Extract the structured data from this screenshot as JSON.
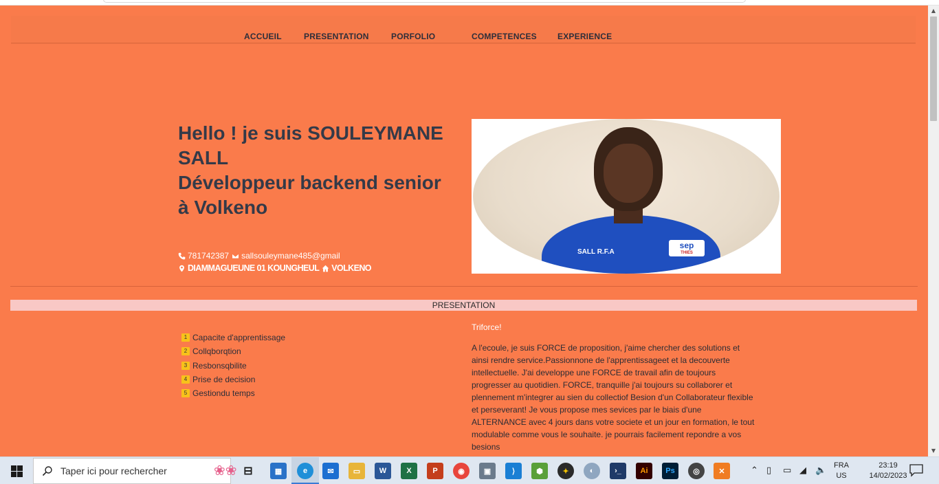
{
  "nav": {
    "items": [
      "ACCUEIL",
      "PRESENTATION",
      "PORFOLIO",
      "COMPETENCES",
      "EXPERIENCE"
    ]
  },
  "hero": {
    "line1": "Hello ! je suis SOULEYMANE",
    "line2": "SALL",
    "line3": "Développeur backend senior",
    "line4": "à Volkeno",
    "phone": "781742387",
    "email": "sallsouleymane485@gmail",
    "address": "DIAMMAGUEUNE 01 KOUNGHEUL",
    "company": "VOLKENO",
    "photo_shirt_text": "SALL R.F.A",
    "photo_badge_text": "sep",
    "photo_badge_sub": "THIES"
  },
  "section": {
    "title": "PRESENTATION"
  },
  "skills": [
    {
      "num": "1",
      "label": "Capacite d'apprentissage"
    },
    {
      "num": "2",
      "label": "Collqborqtion"
    },
    {
      "num": "3",
      "label": "Resbonsqbilite"
    },
    {
      "num": "4",
      "label": "Prise de decision"
    },
    {
      "num": "5",
      "label": "Gestiondu temps"
    }
  ],
  "presentation": {
    "tagline": "Triforce!",
    "body": "A l'ecoule, je suis FORCE de proposition, j'aime chercher des solutions et ainsi rendre service.Passionnone de l'apprentissageet et la decouverte intellectuelle. J'ai developpe une FORCE de travail afin de toujours progresser au quotidien. FORCE, tranquille j'ai toujours su collaborer et plennement m'integrer au sien du collectiof Besion d'un Collaborateur flexible et perseverant! Je vous propose mes sevices par le biais d'une ALTERNANCE avec 4 jours dans votre societe et un jour en formation, le tout modulable comme vous le souhaite. je pourrais facilement repondre a vos besions"
  },
  "taskbar": {
    "search_placeholder": "Taper ici pour rechercher",
    "lang_top": "FRA",
    "lang_bottom": "US",
    "time": "23:19",
    "date": "14/02/2023"
  },
  "colors": {
    "page_bg": "#fa7b4b",
    "section_bar": "#f9c8c5",
    "badge": "#f7c21a",
    "title_text": "#343a48"
  }
}
